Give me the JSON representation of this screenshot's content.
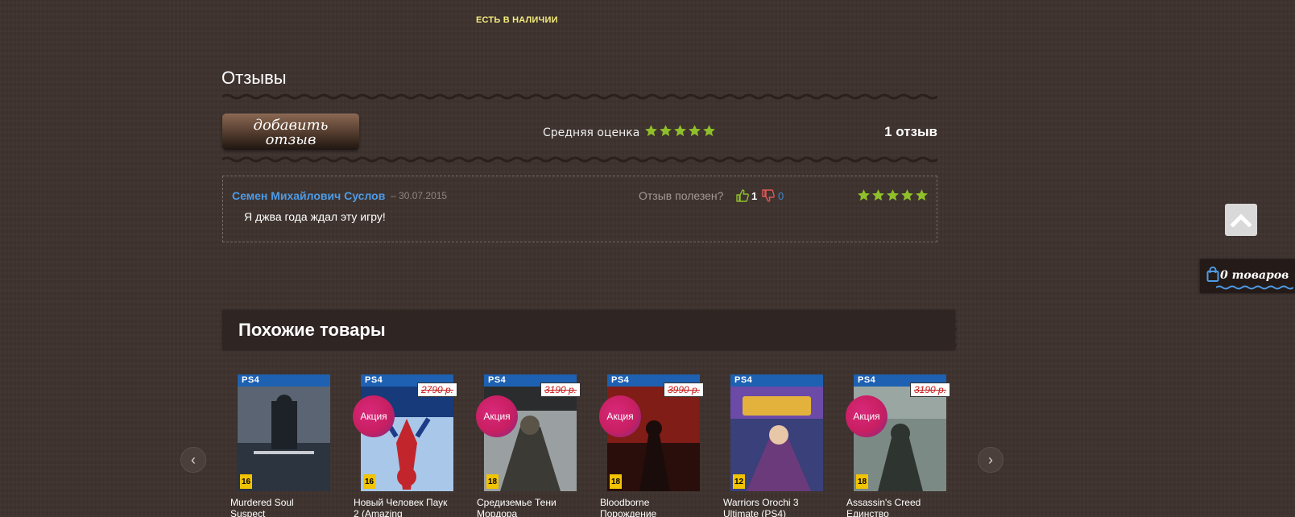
{
  "stock_status": "ЕСТЬ В НАЛИЧИИ",
  "reviews": {
    "title": "Отзывы",
    "add_button_label": "добавить\nотзыв",
    "average_label": "Средняя оценка",
    "average_rating": 5,
    "count_label": "1 отзыв",
    "items": [
      {
        "author": "Семен Михайлович Суслов",
        "date_separator": "–",
        "date": "30.07.2015",
        "text": "Я джва года ждал эту игру!",
        "helpful_label": "Отзыв полезен?",
        "likes": "1",
        "dislikes": "0",
        "rating": 5
      }
    ]
  },
  "cart": {
    "label": "0 товаров"
  },
  "similar": {
    "title": "Похожие товары",
    "prev_label": "‹",
    "next_label": "›",
    "platform_label": "PS4",
    "products": [
      {
        "name": "Murdered Soul Suspect",
        "old_price": "",
        "sale": "",
        "age": "16",
        "art": "murdered"
      },
      {
        "name": "Новый Человек Паук 2 (Amazing",
        "old_price": "2790 р.",
        "sale": "Акция",
        "age": "16",
        "art": "spiderman"
      },
      {
        "name": "Средиземье Тени Мордора",
        "old_price": "3190 р.",
        "sale": "Акция",
        "age": "18",
        "art": "mordor"
      },
      {
        "name": "Bloodborne Порождение",
        "old_price": "3990 р.",
        "sale": "Акция",
        "age": "18",
        "art": "bloodborne"
      },
      {
        "name": "Warriors Orochi 3 Ultimate (PS4)",
        "old_price": "",
        "sale": "",
        "age": "12",
        "art": "orochi"
      },
      {
        "name": "Assassin's Creed Единство",
        "old_price": "3190 р.",
        "sale": "Акция",
        "age": "18",
        "art": "assassin"
      }
    ]
  },
  "colors": {
    "accent_link": "#4d9be6",
    "star": "#8fbf2a",
    "stock": "#f3eb7e",
    "sale_badge": "#c81f62",
    "old_price": "#c81b1b"
  }
}
